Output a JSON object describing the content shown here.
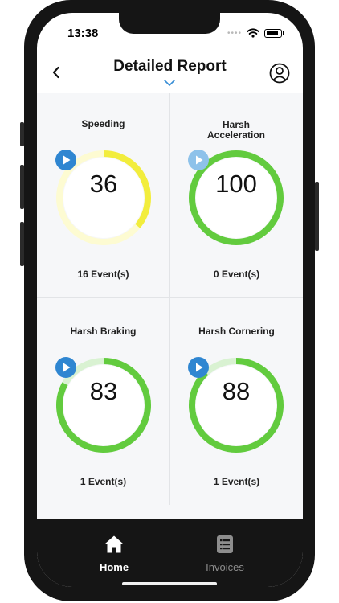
{
  "status_bar": {
    "time": "13:38"
  },
  "header": {
    "title": "Detailed Report"
  },
  "colors": {
    "green": "#62cb3e",
    "green_light": "#d9f2d2",
    "yellow": "#f2ed3d",
    "yellow_light": "#fdfbd2",
    "play_blue": "#2f86d1",
    "play_blue_light": "#8ec2ea",
    "chevron_blue": "#3a8fd6"
  },
  "metrics": [
    {
      "title": "Speeding",
      "score": "36",
      "percent": 36,
      "events": "16 Event(s)",
      "color": "yellow",
      "play_enabled": true
    },
    {
      "title": "Harsh Acceleration",
      "score": "100",
      "percent": 100,
      "events": "0 Event(s)",
      "color": "green",
      "play_enabled": false
    },
    {
      "title": "Harsh Braking",
      "score": "83",
      "percent": 83,
      "events": "1 Event(s)",
      "color": "green",
      "play_enabled": true
    },
    {
      "title": "Harsh Cornering",
      "score": "88",
      "percent": 88,
      "events": "1 Event(s)",
      "color": "green",
      "play_enabled": true
    }
  ],
  "tabbar": {
    "items": [
      {
        "label": "Home",
        "icon": "home-icon",
        "active": true
      },
      {
        "label": "Invoices",
        "icon": "invoice-list-icon",
        "active": false
      }
    ]
  }
}
